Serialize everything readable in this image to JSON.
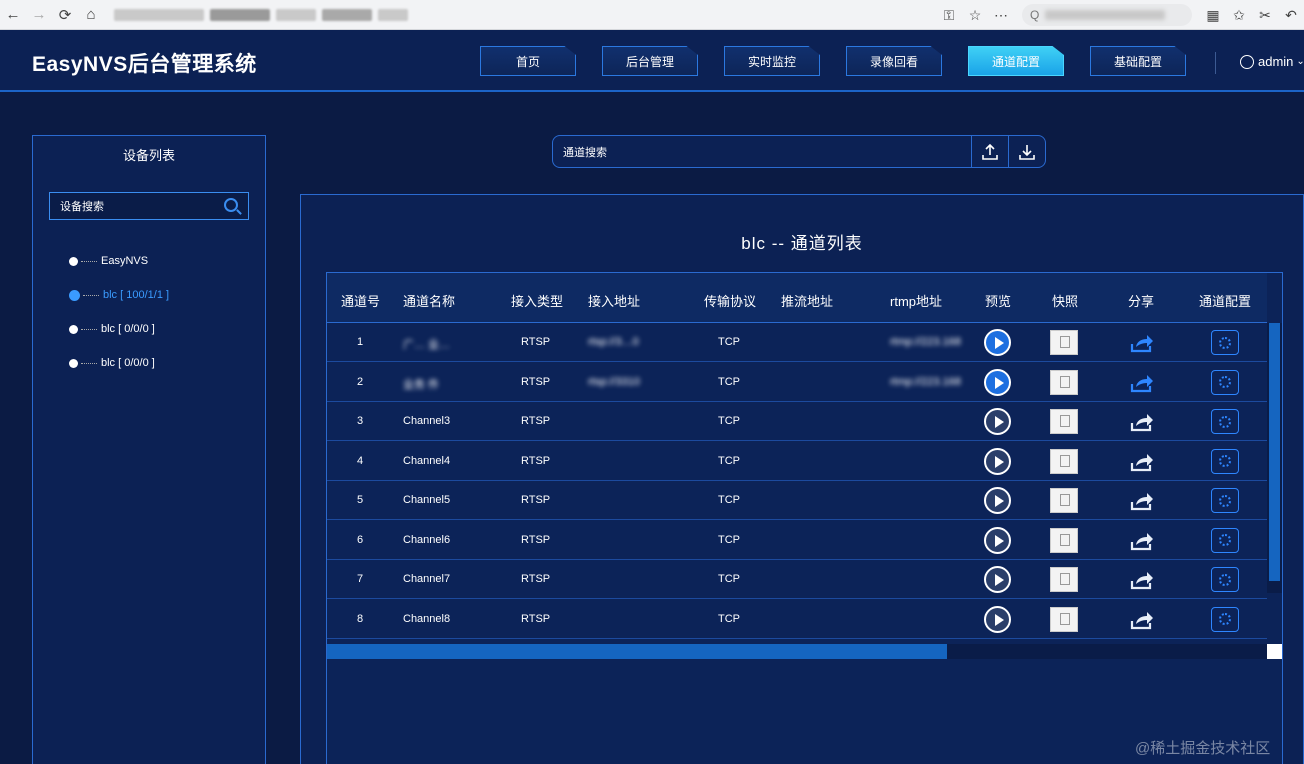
{
  "browser": {
    "back": "←",
    "forward": "→",
    "reload": "⟳",
    "home": "⌂",
    "search_placeholder": "Q",
    "right_icons": [
      "⚿",
      "☆",
      "⋯",
      "▦",
      "✩",
      "✂",
      "↶"
    ]
  },
  "app": {
    "title": "EasyNVS后台管理系统",
    "nav": [
      "首页",
      "后台管理",
      "实时监控",
      "录像回看",
      "通道配置",
      "基础配置"
    ],
    "active_nav": "通道配置",
    "user": "admin"
  },
  "device_panel": {
    "title": "设备列表",
    "search_placeholder": "设备搜索",
    "tree": [
      {
        "label": "EasyNVS",
        "active": false
      },
      {
        "label": "blc [ 100/1/1 ]",
        "active": true
      },
      {
        "label": "blc [ 0/0/0 ]",
        "active": false
      },
      {
        "label": "blc [ 0/0/0 ]",
        "active": false
      }
    ]
  },
  "channel_search": {
    "placeholder": "通道搜索"
  },
  "main": {
    "title": "blc -- 通道列表",
    "columns": [
      "通道号",
      "通道名称",
      "接入类型",
      "接入地址",
      "传输协议",
      "推流地址",
      "rtmp地址",
      "预览",
      "快照",
      "分享",
      "通道配置"
    ],
    "rows": [
      {
        "no": "1",
        "name": "广… 业…",
        "type": "RTSP",
        "addr": "rtsp://3…0",
        "proto": "TCP",
        "push": "",
        "rtmp": "rtmp://223.168",
        "live": true
      },
      {
        "no": "2",
        "name": "业务 件",
        "type": "RTSP",
        "addr": "rtsp://3310",
        "proto": "TCP",
        "push": "",
        "rtmp": "rtmp://223.168",
        "live": true
      },
      {
        "no": "3",
        "name": "Channel3",
        "type": "RTSP",
        "addr": "",
        "proto": "TCP",
        "push": "",
        "rtmp": "",
        "live": false
      },
      {
        "no": "4",
        "name": "Channel4",
        "type": "RTSP",
        "addr": "",
        "proto": "TCP",
        "push": "",
        "rtmp": "",
        "live": false
      },
      {
        "no": "5",
        "name": "Channel5",
        "type": "RTSP",
        "addr": "",
        "proto": "TCP",
        "push": "",
        "rtmp": "",
        "live": false
      },
      {
        "no": "6",
        "name": "Channel6",
        "type": "RTSP",
        "addr": "",
        "proto": "TCP",
        "push": "",
        "rtmp": "",
        "live": false
      },
      {
        "no": "7",
        "name": "Channel7",
        "type": "RTSP",
        "addr": "",
        "proto": "TCP",
        "push": "",
        "rtmp": "",
        "live": false
      },
      {
        "no": "8",
        "name": "Channel8",
        "type": "RTSP",
        "addr": "",
        "proto": "TCP",
        "push": "",
        "rtmp": "",
        "live": false
      }
    ]
  },
  "watermark": "@稀土掘金技术社区",
  "colors": {
    "bg": "#0b1b44",
    "panel": "#0c2154",
    "accent": "#2a6ad0",
    "active_tab": "#3fd0f5",
    "live_blue": "#1d6fe0"
  }
}
